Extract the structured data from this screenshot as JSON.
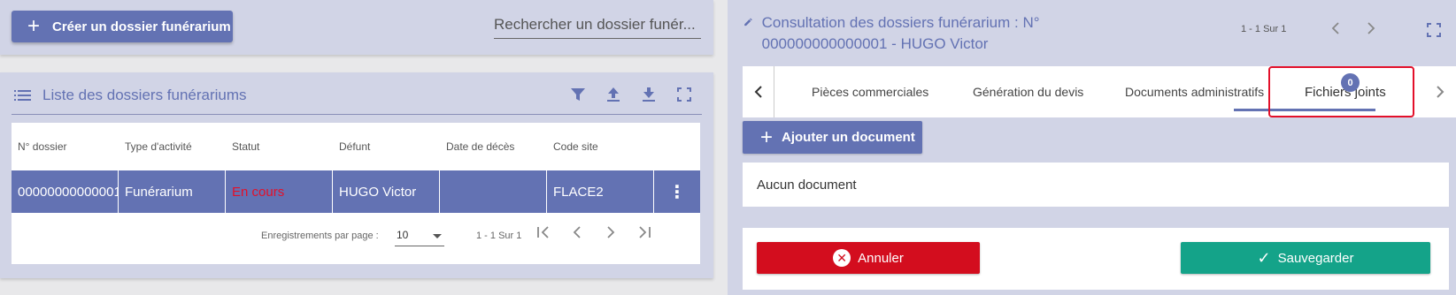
{
  "toolbar": {
    "create_label": "Créer un dossier funérarium",
    "search_placeholder": "Rechercher un dossier funér..."
  },
  "list": {
    "title": "Liste des dossiers funérariums",
    "columns": [
      "N° dossier",
      "Type d'activité",
      "Statut",
      "Défunt",
      "Date de décès",
      "Code site"
    ],
    "rows": [
      {
        "dossier": "00000000000001",
        "type": "Funérarium",
        "statut": "En cours",
        "defunt": "HUGO Victor",
        "date": "",
        "code": "FLACE2"
      }
    ],
    "pager": {
      "rpp_label": "Enregistrements par page :",
      "rpp_value": "10",
      "range": "1 - 1 Sur 1"
    },
    "tools": [
      "filter-icon",
      "upload-icon",
      "download-icon",
      "fullscreen-icon"
    ]
  },
  "detail": {
    "title": "Consultation des dossiers funérarium : N° 000000000000001 - HUGO Victor",
    "range": "1 - 1 Sur 1",
    "tabs": [
      {
        "label": "Pièces commerciales"
      },
      {
        "label": "Génération du devis"
      },
      {
        "label": "Documents administratifs"
      },
      {
        "label": "Fichiers joints",
        "badge": "0",
        "active": true
      }
    ],
    "add_document_label": "Ajouter un document",
    "empty_label": "Aucun document",
    "cancel_label": "Annuler",
    "save_label": "Sauvegarder"
  },
  "colors": {
    "accent": "#6372b3",
    "panel": "#d1d4e6",
    "danger": "#d30d1e",
    "success": "#14a389",
    "status_text": "#e3102a"
  }
}
